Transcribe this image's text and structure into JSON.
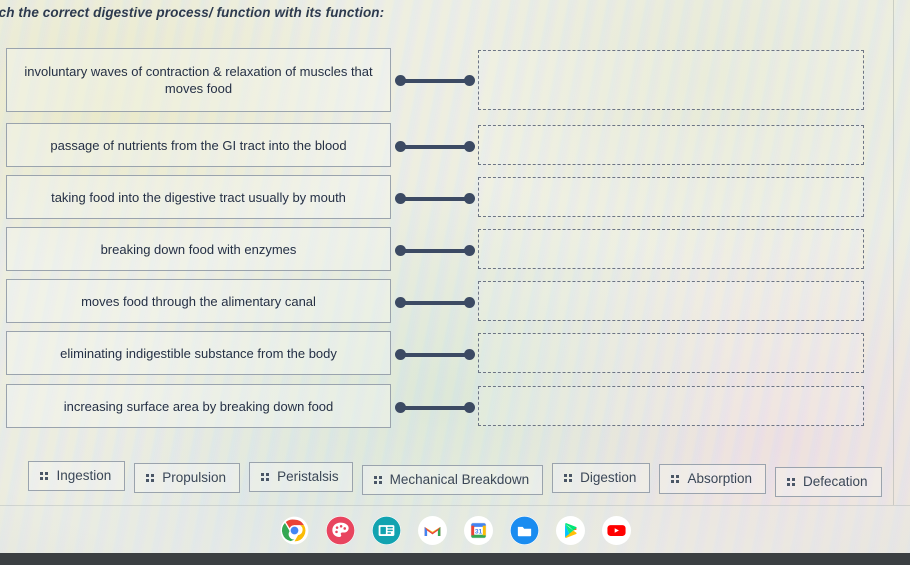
{
  "prompt": "tch the correct digestive process/ function with its function:",
  "matching": {
    "terms": [
      "involuntary waves of contraction & relaxation of muscles that moves food",
      "passage of nutrients from the GI tract into the blood",
      "taking food into the digestive tract usually by mouth",
      "breaking down food with enzymes",
      "moves food through the alimentary canal",
      "eliminating indigestible substance from the body",
      "increasing surface area by breaking down food"
    ],
    "dropzones": [
      "",
      "",
      "",
      "",
      "",
      "",
      ""
    ]
  },
  "answer_chips": [
    {
      "label": "Ingestion",
      "handle": "drag-handle-icon"
    },
    {
      "label": "Propulsion",
      "handle": "drag-handle-icon"
    },
    {
      "label": "Peristalsis",
      "handle": "drag-handle-icon"
    },
    {
      "label": "Mechanical Breakdown",
      "handle": "drag-handle-icon"
    },
    {
      "label": "Digestion",
      "handle": "drag-handle-icon"
    },
    {
      "label": "Absorption",
      "handle": "drag-handle-icon"
    },
    {
      "label": "Defecation",
      "handle": "drag-handle-icon"
    }
  ],
  "shelf": {
    "icons": [
      {
        "name": "chrome-icon",
        "running": true
      },
      {
        "name": "art-palette-icon",
        "running": false
      },
      {
        "name": "news-article-icon",
        "running": false
      },
      {
        "name": "gmail-icon",
        "running": false
      },
      {
        "name": "google-calendar-icon",
        "running": false
      },
      {
        "name": "files-folder-icon",
        "running": false
      },
      {
        "name": "play-store-icon",
        "running": false
      },
      {
        "name": "youtube-icon",
        "running": false
      }
    ]
  },
  "colors": {
    "connector": "#3c4a63",
    "box_border": "#9aa3ad",
    "dropzone_border": "#6d7585",
    "text": "#253045",
    "bezel": "#3b3f42"
  }
}
